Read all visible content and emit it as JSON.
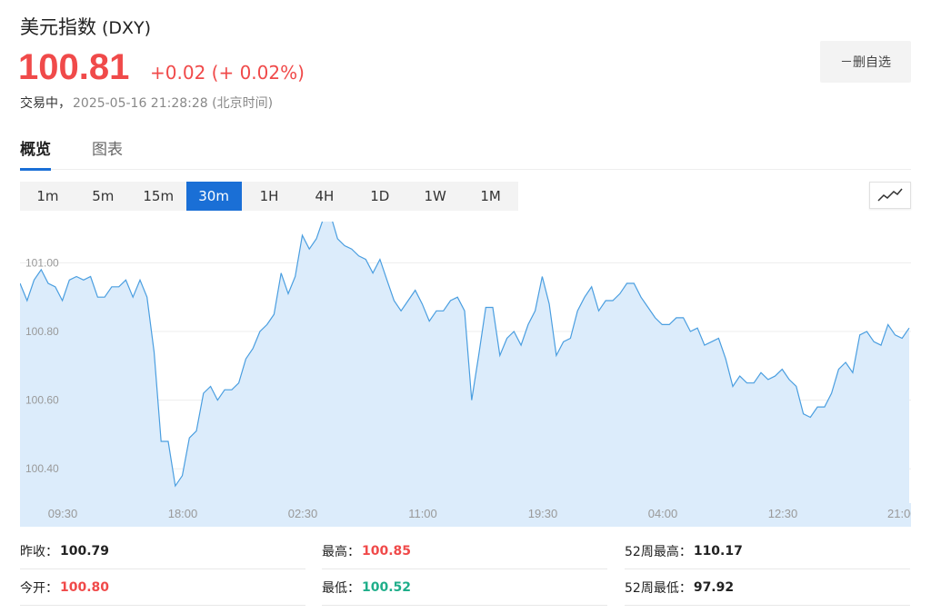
{
  "header": {
    "name": "美元指数",
    "code": "(DXY)",
    "price": "100.81",
    "change": "+0.02 (+ 0.02%)",
    "status": "交易中，",
    "timestamp": "2025-05-16 21:28:28 (北京时间)",
    "watch_button": "－删自选",
    "up_color": "#f04a4a",
    "down_color": "#1fae8a"
  },
  "tabs": [
    {
      "label": "概览",
      "active": true
    },
    {
      "label": "图表",
      "active": false
    }
  ],
  "timeframes": [
    {
      "label": "1m",
      "active": false
    },
    {
      "label": "5m",
      "active": false
    },
    {
      "label": "15m",
      "active": false
    },
    {
      "label": "30m",
      "active": true
    },
    {
      "label": "1H",
      "active": false
    },
    {
      "label": "4H",
      "active": false
    },
    {
      "label": "1D",
      "active": false
    },
    {
      "label": "1W",
      "active": false
    },
    {
      "label": "1M",
      "active": false
    }
  ],
  "chart_type_icon": "line-chart-icon",
  "chart_data": {
    "type": "area",
    "x_labels": [
      "09:30",
      "18:00",
      "02:30",
      "11:00",
      "19:30",
      "04:00",
      "12:30",
      "21:00"
    ],
    "y_ticks": [
      "101.00",
      "100.80",
      "100.60",
      "100.40"
    ],
    "ylim": [
      100.3,
      101.12
    ],
    "line_color": "#4a9ee0",
    "fill_color": "#dcecfb",
    "grid": true,
    "values": [
      100.94,
      100.89,
      100.95,
      100.98,
      100.94,
      100.93,
      100.89,
      100.95,
      100.96,
      100.95,
      100.96,
      100.9,
      100.9,
      100.93,
      100.93,
      100.95,
      100.9,
      100.95,
      100.9,
      100.74,
      100.48,
      100.48,
      100.35,
      100.38,
      100.49,
      100.51,
      100.62,
      100.64,
      100.6,
      100.63,
      100.63,
      100.65,
      100.72,
      100.75,
      100.8,
      100.82,
      100.85,
      100.97,
      100.91,
      100.96,
      101.08,
      101.04,
      101.07,
      101.13,
      101.14,
      101.07,
      101.05,
      101.04,
      101.02,
      101.01,
      100.97,
      101.01,
      100.95,
      100.89,
      100.86,
      100.89,
      100.92,
      100.88,
      100.83,
      100.86,
      100.86,
      100.89,
      100.9,
      100.86,
      100.6,
      100.73,
      100.87,
      100.87,
      100.73,
      100.78,
      100.8,
      100.76,
      100.82,
      100.86,
      100.96,
      100.88,
      100.73,
      100.77,
      100.78,
      100.86,
      100.9,
      100.93,
      100.86,
      100.89,
      100.89,
      100.91,
      100.94,
      100.94,
      100.9,
      100.87,
      100.84,
      100.82,
      100.82,
      100.84,
      100.84,
      100.8,
      100.81,
      100.76,
      100.77,
      100.78,
      100.72,
      100.64,
      100.67,
      100.65,
      100.65,
      100.68,
      100.66,
      100.67,
      100.69,
      100.66,
      100.64,
      100.56,
      100.55,
      100.58,
      100.58,
      100.62,
      100.69,
      100.71,
      100.68,
      100.79,
      100.8,
      100.77,
      100.76,
      100.82,
      100.79,
      100.78,
      100.81
    ]
  },
  "stats": [
    {
      "label": "昨收：",
      "value": "100.79",
      "tone": "neutral"
    },
    {
      "label": "最高：",
      "value": "100.85",
      "tone": "up"
    },
    {
      "label": "52周最高：",
      "value": "110.17",
      "tone": "neutral"
    },
    {
      "label": "今开：",
      "value": "100.80",
      "tone": "up"
    },
    {
      "label": "最低：",
      "value": "100.52",
      "tone": "down"
    },
    {
      "label": "52周最低：",
      "value": "97.92",
      "tone": "neutral"
    }
  ]
}
